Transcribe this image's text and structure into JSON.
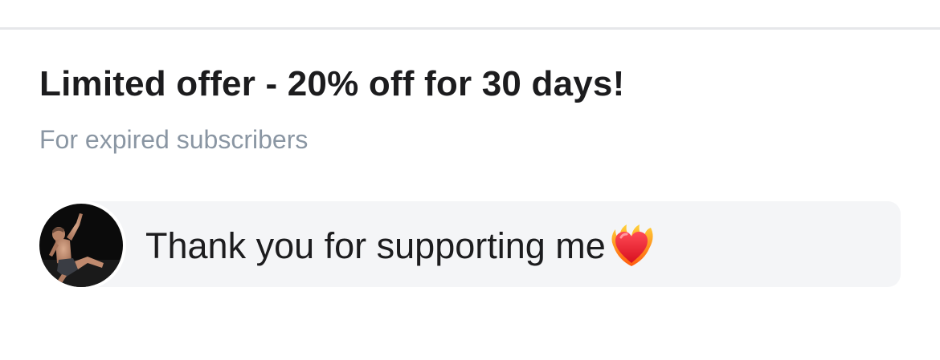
{
  "offer": {
    "title": "Limited offer - 20% off for 30 days!",
    "subtitle": "For expired subscribers"
  },
  "message": {
    "text": "Thank you for supporting me",
    "emoji_icon": "heart-on-fire-icon"
  },
  "colors": {
    "title": "#1c1c1e",
    "subtitle": "#8a96a3",
    "bubble_background": "#f4f5f7",
    "divider": "#e6e7ea"
  }
}
